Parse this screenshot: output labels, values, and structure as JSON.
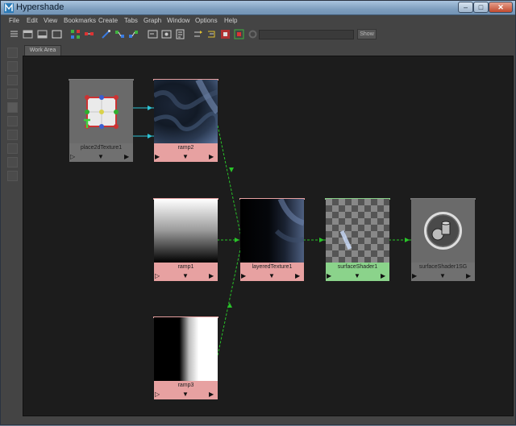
{
  "window": {
    "title": "Hypershade",
    "minimize_glyph": "‒",
    "maximize_glyph": "□",
    "close_glyph": "✕"
  },
  "menu": [
    "File",
    "Edit",
    "View",
    "Bookmarks",
    "Create",
    "Tabs",
    "Graph",
    "Window",
    "Options",
    "Help"
  ],
  "toolbar": {
    "show_label": "Show",
    "filter_value": ""
  },
  "tabs": [
    {
      "label": "Work Area"
    }
  ],
  "nodes": {
    "placed": {
      "name": "place2dTexture1",
      "in": "▷",
      "mid": "▼",
      "out": "▶"
    },
    "ramp2": {
      "name": "ramp2",
      "in": "▶",
      "mid": "▼",
      "out": "▶"
    },
    "ramp1": {
      "name": "ramp1",
      "in": "▷",
      "mid": "▼",
      "out": "▶"
    },
    "ramp3": {
      "name": "ramp3",
      "in": "▷",
      "mid": "▼",
      "out": "▶"
    },
    "layered": {
      "name": "layeredTexture1",
      "in": "▶",
      "mid": "▼",
      "out": "▶"
    },
    "surface": {
      "name": "surfaceShader1",
      "in": "▶",
      "mid": "▼",
      "out": "▶"
    },
    "sg": {
      "name": "surfaceShader1SG",
      "in": "▶",
      "mid": "▼",
      "out": "▶"
    }
  },
  "colors": {
    "texture_node": "#e7a1a1",
    "shader_node": "#8bd38b",
    "shading_group_node": "#707070",
    "connection_green": "#29c329",
    "connection_cyan": "#2ec4d6",
    "canvas_bg": "#1c1c1c"
  }
}
